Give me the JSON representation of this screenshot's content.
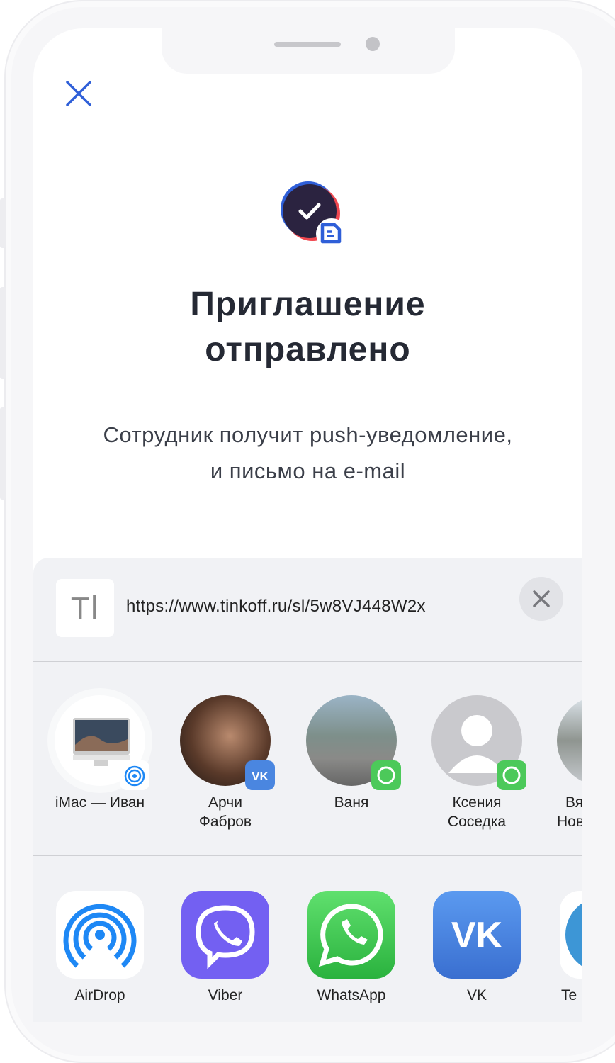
{
  "title_line1": "Приглашение",
  "title_line2": "отправлено",
  "subtitle_line1": "Сотрудник получит push-уведомление,",
  "subtitle_line2": "и письмо на e-mail",
  "share": {
    "link": "https://www.tinkoff.ru/sl/5w8VJ448W2x",
    "link_icon_glyph": "T𝙸",
    "people": [
      {
        "l1": "iMac — Иван",
        "l2": "",
        "badge": "airdrop"
      },
      {
        "l1": "Арчи",
        "l2": "Фабров",
        "badge": "vk"
      },
      {
        "l1": "Ваня",
        "l2": "",
        "badge": "whatsapp"
      },
      {
        "l1": "Ксения",
        "l2": "Соседка",
        "badge": "whatsapp"
      },
      {
        "l1": "Вя",
        "l2": "Нов",
        "badge": ""
      }
    ],
    "apps": [
      {
        "name": "AirDrop",
        "color": "#ffffff"
      },
      {
        "name": "Viber",
        "color": "#7360f2"
      },
      {
        "name": "WhatsApp",
        "color": "#4cc95a"
      },
      {
        "name": "VK",
        "color": "#4a86e0"
      },
      {
        "name": "Te",
        "color": "#3d96d6"
      }
    ]
  },
  "colors": {
    "accent": "#2f5fd8",
    "dark": "#2b2340",
    "red": "#f0474f"
  }
}
